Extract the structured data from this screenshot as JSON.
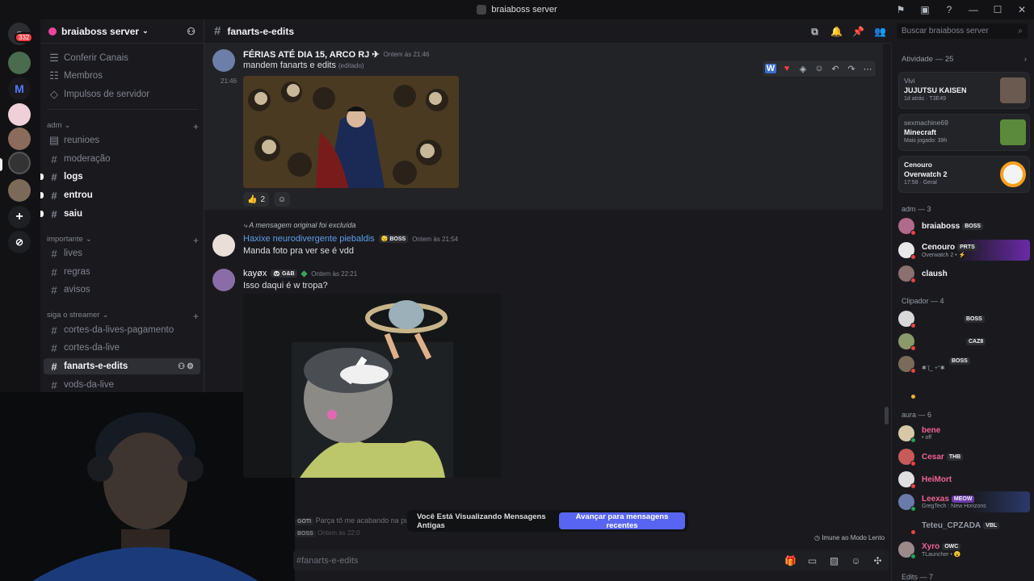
{
  "window": {
    "title": "braiaboss server"
  },
  "guilds": {
    "mention_count": "332"
  },
  "sidebar": {
    "server_name": "braiaboss server",
    "top_items": [
      {
        "label": "Conferir Canais"
      },
      {
        "label": "Membros"
      },
      {
        "label": "Impulsos de servidor"
      }
    ],
    "categories": [
      {
        "name": "adm",
        "channels": [
          "reunioes",
          "moderação",
          "logs",
          "entrou",
          "saiu"
        ]
      },
      {
        "name": "importante",
        "channels": [
          "lives",
          "regras",
          "avisos"
        ]
      },
      {
        "name": "siga o streamer",
        "channels": [
          "cortes-da-lives-pagamento",
          "cortes-da-live",
          "fanarts-e-edits",
          "vods-da-live"
        ]
      }
    ]
  },
  "header": {
    "channel": "fanarts-e-edits",
    "search_placeholder": "Buscar braiaboss server"
  },
  "messages": [
    {
      "author": "FÉRIAS ATÉ DIA 15, ARCO RJ ✈",
      "time": "Ontem às 21:46",
      "text": "mandem fanarts e edits",
      "edited": "(editado)",
      "side_time": "21:46",
      "reaction_count": "2"
    },
    {
      "reply_note": "A mensagem original foi excluída",
      "author": "Haxixe neurodivergente piebaldis",
      "tag": "BOSS",
      "time": "Ontem às 21:54",
      "text": "Manda foto pra ver se é vdd"
    },
    {
      "author": "kayøx",
      "tag": "G&B",
      "time": "Ontem às 22:21",
      "text": "Isso daqui é w tropa?"
    },
    {
      "tag": "GOTI",
      "text": "Parça tô me acabando na pu",
      "tag2": "BOSS",
      "time": "Ontem às 22:0"
    }
  ],
  "banner": {
    "text": "Você Está Visualizando Mensagens Antigas",
    "button": "Avançar para mensagens recentes"
  },
  "slowmode": "Imune ao Modo Lento",
  "composer": {
    "placeholder": "#fanarts-e-edits"
  },
  "members": {
    "activity_header": "Atividade — 25",
    "activities": [
      {
        "user": "Vivi",
        "game": "JUJUTSU KAISEN",
        "detail": "1d atrás · T3E49"
      },
      {
        "user": "sexmachine69",
        "game": "Minecraft",
        "detail": "Mais jogado: 39h"
      },
      {
        "user": "Cenouro",
        "game": "Overwatch 2",
        "detail": "17:58 · Geral"
      }
    ],
    "adm_header": "adm — 3",
    "adm": [
      {
        "name": "braiaboss",
        "tag": "BOSS",
        "sub": ""
      },
      {
        "name": "Cenouro",
        "tag": "PRTS",
        "sub": "Overwatch 2 • ⚡"
      },
      {
        "name": "claush",
        "tag": "",
        "sub": ""
      }
    ],
    "clip_header": "Clipador — 4",
    "clip": [
      {
        "tag": "BOSS",
        "sub": ""
      },
      {
        "tag": "CAZ8",
        "sub": ""
      },
      {
        "tag": "BOSS",
        "sub": "✱ᐝ(_ +°✱"
      },
      {
        "tag": "",
        "sub": ""
      }
    ],
    "aura_header": "aura — 6",
    "aura": [
      {
        "name": "bene",
        "color": "#f06292",
        "tag": "",
        "sub": "• off"
      },
      {
        "name": "Cesar",
        "color": "#f06292",
        "tag": "THB",
        "sub": ""
      },
      {
        "name": "HeiMort",
        "color": "#f06292",
        "tag": "",
        "sub": ""
      },
      {
        "name": "Leexas",
        "color": "#f06292",
        "tag": "MEOW",
        "sub": "GregTech : New Horizons"
      },
      {
        "name": "Teteu_CPZADA",
        "color": "#949ba4",
        "tag": "VBL",
        "sub": ""
      },
      {
        "name": "Xyro",
        "color": "#f06292",
        "tag": "OWC",
        "sub": "TLauncher • 😮"
      }
    ],
    "edits_header": "Edits — 7"
  }
}
